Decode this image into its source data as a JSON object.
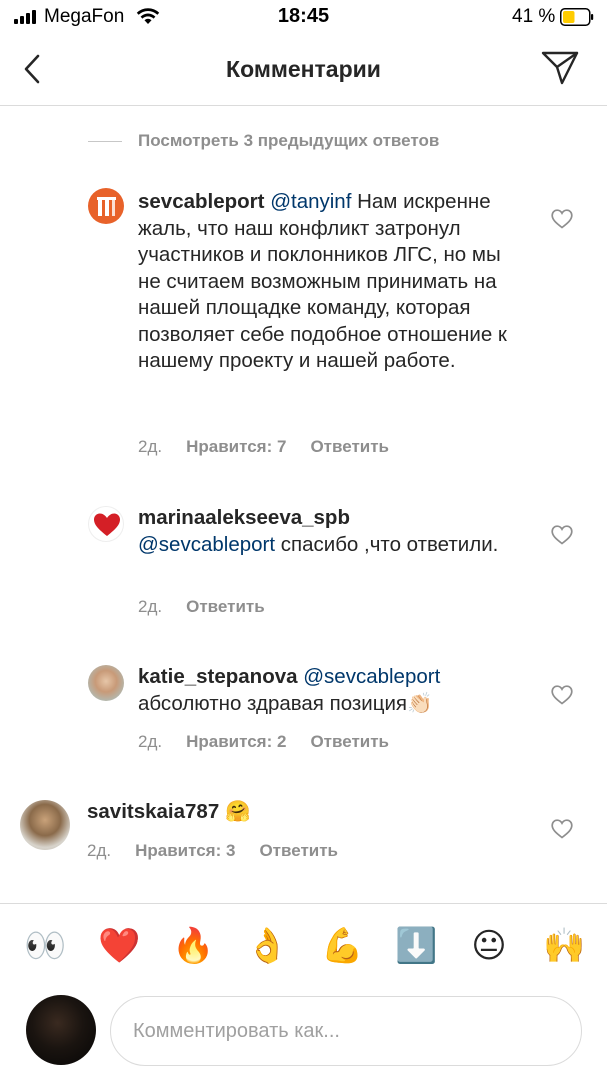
{
  "status_bar": {
    "carrier": "MegaFon",
    "time": "18:45",
    "battery": "41 %"
  },
  "header": {
    "title": "Комментарии",
    "back_icon": "chevron-left-icon",
    "send_icon": "paper-plane-icon"
  },
  "thread": {
    "view_previous": "Посмотреть 3 предыдущих ответов"
  },
  "comments": [
    {
      "username": "sevcableport",
      "mention": "@tanyinf",
      "text": " Нам искренне жаль, что наш конфликт затронул участников и поклонников ЛГС, но мы не считаем возможным принимать на нашей площадке команду, которая позволяет себе подобное отношение к нашему проекту и нашей работе.",
      "time": "2д.",
      "likes": "Нравится: 7",
      "reply": "Ответить"
    },
    {
      "username": "marinaalekseeva_spb",
      "mention": "@sevcableport",
      "text": " спасибо ,что ответили.",
      "time": "2д.",
      "reply": "Ответить"
    },
    {
      "username": "katie_stepanova",
      "mention": "@sevcableport",
      "text": " абсолютно здравая позиция",
      "emoji": "👏🏻",
      "time": "2д.",
      "likes": "Нравится: 2",
      "reply": "Ответить"
    },
    {
      "username": "savitskaia787",
      "emoji": "🤗",
      "time": "2д.",
      "likes": "Нравится: 3",
      "reply": "Ответить"
    }
  ],
  "emoji_bar": [
    "👀",
    "❤️",
    "🔥",
    "👌",
    "💪",
    "⬇️",
    "😐",
    "🙌"
  ],
  "composer": {
    "placeholder": "Комментировать как..."
  },
  "colors": {
    "text": "#262626",
    "muted": "#8e8e8e",
    "mention": "#00376b",
    "divider": "#dbdbdb",
    "battery": "#ffcc00"
  }
}
